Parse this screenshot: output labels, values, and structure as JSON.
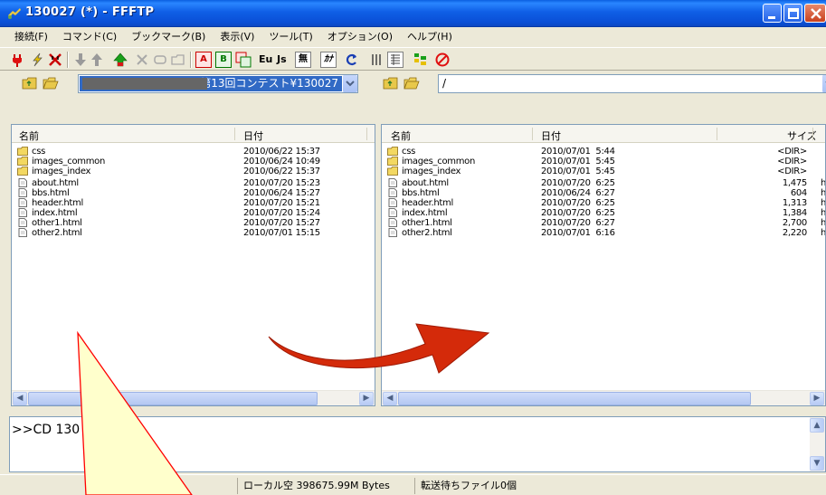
{
  "window": {
    "title": "130027 (*) - FFFTP"
  },
  "menu": [
    "接続(F)",
    "コマンド(C)",
    "ブックマーク(B)",
    "表示(V)",
    "ツール(T)",
    "オプション(O)",
    "ヘルプ(H)"
  ],
  "toolbar": {
    "mode_ascii": "A",
    "mode_binary": "B",
    "kanji_euc": "Eu",
    "kanji_jis": "Js",
    "no_convert": "無",
    "kana": "ｶﾅ"
  },
  "local": {
    "path": "第13回コンテスト¥130027",
    "columns": {
      "name": "名前",
      "date": "日付"
    },
    "files": [
      {
        "name": "css",
        "date": "2010/06/22 15:37",
        "type": "folder"
      },
      {
        "name": "images_common",
        "date": "2010/06/24 10:49",
        "type": "folder"
      },
      {
        "name": "images_index",
        "date": "2010/06/22 15:37",
        "type": "folder"
      },
      {
        "name": "about.html",
        "date": "2010/07/20 15:23",
        "type": "file"
      },
      {
        "name": "bbs.html",
        "date": "2010/06/24 15:27",
        "type": "file"
      },
      {
        "name": "header.html",
        "date": "2010/07/20 15:21",
        "type": "file"
      },
      {
        "name": "index.html",
        "date": "2010/07/20 15:24",
        "type": "file"
      },
      {
        "name": "other1.html",
        "date": "2010/07/20 15:27",
        "type": "file"
      },
      {
        "name": "other2.html",
        "date": "2010/07/01 15:15",
        "type": "file"
      }
    ]
  },
  "remote": {
    "path": "/",
    "columns": {
      "name": "名前",
      "date": "日付",
      "size": "サイズ"
    },
    "files": [
      {
        "name": "css",
        "date": "2010/07/01  5:44",
        "size": "<DIR>",
        "type": "folder",
        "extra": ""
      },
      {
        "name": "images_common",
        "date": "2010/07/01  5:45",
        "size": "<DIR>",
        "type": "folder",
        "extra": ""
      },
      {
        "name": "images_index",
        "date": "2010/07/01  5:45",
        "size": "<DIR>",
        "type": "folder",
        "extra": ""
      },
      {
        "name": "about.html",
        "date": "2010/07/20  6:25",
        "size": "1,475",
        "type": "file",
        "extra": "h"
      },
      {
        "name": "bbs.html",
        "date": "2010/06/24  6:27",
        "size": "604",
        "type": "file",
        "extra": "h"
      },
      {
        "name": "header.html",
        "date": "2010/07/20  6:25",
        "size": "1,313",
        "type": "file",
        "extra": "h"
      },
      {
        "name": "index.html",
        "date": "2010/07/20  6:25",
        "size": "1,384",
        "type": "file",
        "extra": "h"
      },
      {
        "name": "other1.html",
        "date": "2010/07/20  6:27",
        "size": "2,700",
        "type": "file",
        "extra": "h"
      },
      {
        "name": "other2.html",
        "date": "2010/07/01  6:16",
        "size": "2,220",
        "type": "file",
        "extra": "h"
      }
    ]
  },
  "log": {
    "text": ">>CD 130"
  },
  "status": {
    "local_free": "ローカル空 398675.99M Bytes",
    "queue": "転送待ちファイル0個"
  },
  "colors": {
    "titlebar": "#0a5fe0",
    "arrow": "#d42a0a",
    "callout_fill": "#ffffcc",
    "callout_stroke": "#ff0000"
  }
}
